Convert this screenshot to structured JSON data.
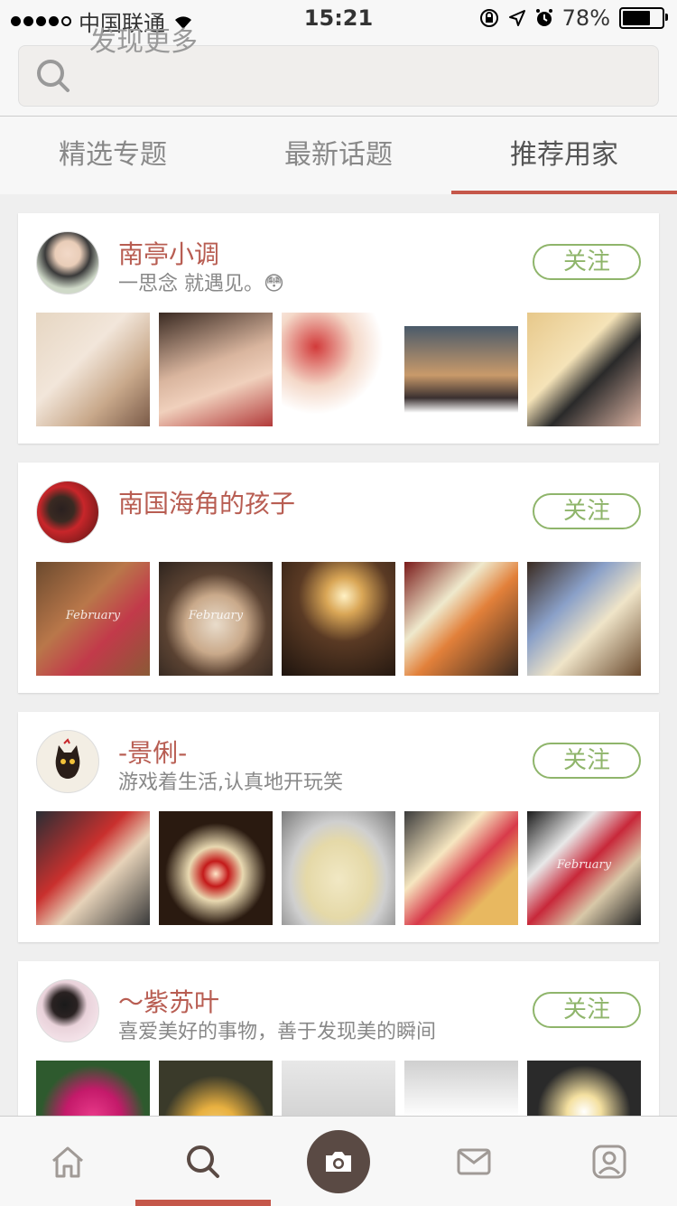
{
  "status_bar": {
    "carrier": "中国联通",
    "time": "15:21",
    "battery": "78%",
    "battery_level": 0.78
  },
  "search": {
    "placeholder": "发现更多"
  },
  "tabs": [
    {
      "label": "精选专题",
      "active": false
    },
    {
      "label": "最新话题",
      "active": false
    },
    {
      "label": "推荐用家",
      "active": true
    }
  ],
  "users": [
    {
      "name": "南亭小调",
      "bio": "一思念 就遇见。😳",
      "follow_label": "关注",
      "photos": [
        {
          "label": "",
          "bg": "linear-gradient(135deg,#e6d6c2,#f2e6da 40%,#c8a88a 70%,#7a5a48)"
        },
        {
          "label": "",
          "bg": "linear-gradient(160deg,#3a2a22,#d9b59e 45%,#f0d0bc 65%,#b23a3a)"
        },
        {
          "label": "",
          "bg": "radial-gradient(circle at 30% 30%,#d23a3a,#f4d8c8 35%,#fff 60%)"
        },
        {
          "label": "",
          "bg": "linear-gradient(180deg,#ffffff 12%,#4a5a6a 12%,#c99a6a 55%,#3a3030 75%,#ffffff 88%)"
        },
        {
          "label": "",
          "bg": "linear-gradient(135deg,#e7c88a,#f5e3b8 40%,#2a2a2a 60%,#d8b0a0)"
        }
      ]
    },
    {
      "name": "南国海角的孩子",
      "bio": "",
      "follow_label": "关注",
      "photos": [
        {
          "label": "February",
          "bg": "linear-gradient(135deg,#6b4a2e,#b9774a 40%,#c23a4a 65%,#8a5a36)"
        },
        {
          "label": "February",
          "bg": "radial-gradient(circle at 50% 55%,#e9dccb 0,#c9a98a 35%,#5a4232 60%,#2e241e)"
        },
        {
          "label": "",
          "bg": "radial-gradient(circle at 55% 30%,#fff1c4 0,#d9a656 18%,#5a3a24 45%,#1e140e)"
        },
        {
          "label": "",
          "bg": "linear-gradient(135deg,#7a1a1a,#efe9cc 35%,#e2803a 55%,#3a2a20)"
        },
        {
          "label": "",
          "bg": "linear-gradient(135deg,#3a2a20,#8aa0c8 35%,#efe4c8 60%,#6a4a2e)"
        }
      ]
    },
    {
      "name": "-景俐-",
      "bio": "游戏着生活,认真地开玩笑",
      "follow_label": "关注",
      "photos": [
        {
          "label": "",
          "bg": "linear-gradient(135deg,#2a2e34,#c9302e 40%,#e6d2b8 60%,#3a3a3a)"
        },
        {
          "label": "",
          "bg": "radial-gradient(circle at 50% 55%,#ffe6c8 0,#c41a1a 15%,#e8d8b0 32%,#2a1a10 60%)"
        },
        {
          "label": "",
          "bg": "radial-gradient(ellipse at 50% 60%,#f1e8c4 0,#e5d9a8 40%,#cfcfcf 60%,#7a7a7a)"
        },
        {
          "label": "",
          "bg": "linear-gradient(135deg,#3a3a3a,#f6e6c0 35%,#d83a4a 55%,#e8b860 75%)"
        },
        {
          "label": "February",
          "bg": "linear-gradient(135deg,#1a1a1a,#e8e8e8 30%,#c8283a 50%,#d8c8a8 70%,#222)"
        }
      ]
    },
    {
      "name": "～紫苏叶",
      "bio": "喜爱美好的事物，善于发现美的瞬间",
      "follow_label": "关注",
      "photos": [
        {
          "label": "",
          "bg": "radial-gradient(circle at 50% 50%,#e93a8a 0,#c41a6a 35%,#2e5a2e 65%)"
        },
        {
          "label": "",
          "bg": "radial-gradient(circle at 50% 60%,#f6d07a 0,#e8b040 25%,#3a3a2a 60%)"
        },
        {
          "label": "",
          "bg": "linear-gradient(180deg,#e8e8e8,#cfcfcf 60%,#6a6a6a)"
        },
        {
          "label": "",
          "bg": "linear-gradient(180deg,#cfcfcf,#ffffff 50%,#3a3a3a)"
        },
        {
          "label": "",
          "bg": "radial-gradient(circle at 50% 45%,#ffffff 0,#f4e0a0 20%,#2a2a2a 55%)"
        }
      ]
    }
  ],
  "tabbar": [
    {
      "name": "home-icon",
      "active": false
    },
    {
      "name": "search-icon",
      "active": true
    },
    {
      "name": "camera-icon",
      "active": false
    },
    {
      "name": "mail-icon",
      "active": false
    },
    {
      "name": "profile-icon",
      "active": false
    }
  ]
}
